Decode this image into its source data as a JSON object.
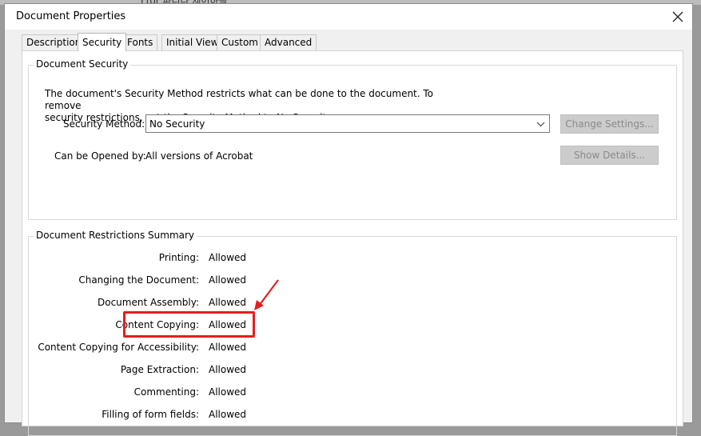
{
  "window": {
    "title": "Document Properties",
    "background_fragment": "Ltor 파디다 제어하을"
  },
  "tabs": [
    {
      "label": "Description",
      "active": false
    },
    {
      "label": "Security",
      "active": true
    },
    {
      "label": "Fonts",
      "active": false
    },
    {
      "label": "Initial View",
      "active": false
    },
    {
      "label": "Custom",
      "active": false
    },
    {
      "label": "Advanced",
      "active": false
    }
  ],
  "security": {
    "group_title": "Document Security",
    "description_line1": "The document's Security Method restricts what can be done to the document. To remove",
    "description_line2": "security restrictions, set the Security Method to No Security.",
    "method_label": "Security Method:",
    "method_value": "No Security",
    "change_settings_label": "Change Settings...",
    "opened_by_label": "Can be Opened by:",
    "opened_by_value": "All versions of Acrobat",
    "show_details_label": "Show Details..."
  },
  "restrictions": {
    "group_title": "Document Restrictions Summary",
    "rows": [
      {
        "label": "Printing:",
        "value": "Allowed"
      },
      {
        "label": "Changing the Document:",
        "value": "Allowed"
      },
      {
        "label": "Document Assembly:",
        "value": "Allowed"
      },
      {
        "label": "Content Copying:",
        "value": "Allowed",
        "highlighted": true
      },
      {
        "label": "Content Copying for Accessibility:",
        "value": "Allowed"
      },
      {
        "label": "Page Extraction:",
        "value": "Allowed"
      },
      {
        "label": "Commenting:",
        "value": "Allowed"
      },
      {
        "label": "Filling of form fields:",
        "value": "Allowed"
      }
    ]
  },
  "colors": {
    "annotation_red": "#e61e1e",
    "disabled_button": "#cccccc"
  }
}
